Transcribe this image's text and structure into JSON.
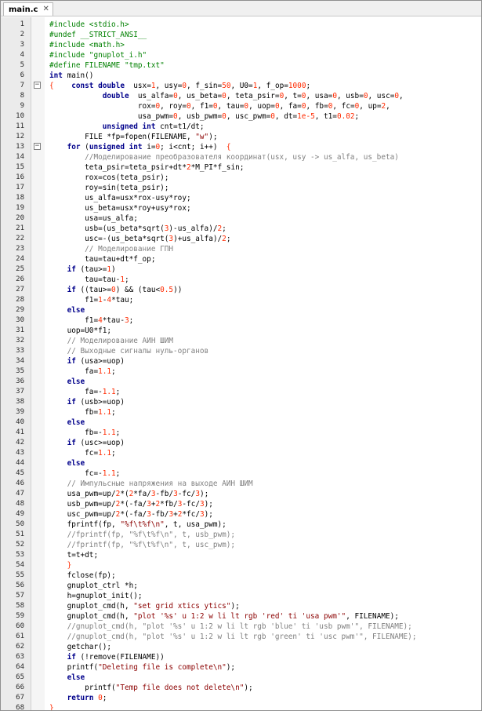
{
  "tab": {
    "label": "main.c",
    "close": "✕"
  },
  "lines": [
    [
      [
        "pp",
        "#include <stdio.h>"
      ]
    ],
    [
      [
        "pp",
        "#undef __STRICT_ANSI__"
      ]
    ],
    [
      [
        "pp",
        "#include <math.h>"
      ]
    ],
    [
      [
        "pp",
        "#include \"gnuplot_i.h\""
      ]
    ],
    [
      [
        "pp",
        "#define FILENAME \"tmp.txt\""
      ]
    ],
    [
      [
        "kw",
        "int"
      ],
      [
        "fn",
        " main()"
      ]
    ],
    [
      [
        "op",
        "{"
      ],
      [
        "fn",
        "    "
      ],
      [
        "kw",
        "const double"
      ],
      [
        "fn",
        "  usx="
      ],
      [
        "num",
        "1"
      ],
      [
        "fn",
        ", usy="
      ],
      [
        "num",
        "0"
      ],
      [
        "fn",
        ", f_sin="
      ],
      [
        "num",
        "50"
      ],
      [
        "fn",
        ", U0="
      ],
      [
        "num",
        "1"
      ],
      [
        "fn",
        ", f_op="
      ],
      [
        "num",
        "1000"
      ],
      [
        "fn",
        ";"
      ]
    ],
    [
      [
        "fn",
        "            "
      ],
      [
        "kw",
        "double"
      ],
      [
        "fn",
        "  us_alfa="
      ],
      [
        "num",
        "0"
      ],
      [
        "fn",
        ", us_beta="
      ],
      [
        "num",
        "0"
      ],
      [
        "fn",
        ", teta_psir="
      ],
      [
        "num",
        "0"
      ],
      [
        "fn",
        ", t="
      ],
      [
        "num",
        "0"
      ],
      [
        "fn",
        ", usa="
      ],
      [
        "num",
        "0"
      ],
      [
        "fn",
        ", usb="
      ],
      [
        "num",
        "0"
      ],
      [
        "fn",
        ", usc="
      ],
      [
        "num",
        "0"
      ],
      [
        "fn",
        ","
      ]
    ],
    [
      [
        "fn",
        "                    rox="
      ],
      [
        "num",
        "0"
      ],
      [
        "fn",
        ", roy="
      ],
      [
        "num",
        "0"
      ],
      [
        "fn",
        ", f1="
      ],
      [
        "num",
        "0"
      ],
      [
        "fn",
        ", tau="
      ],
      [
        "num",
        "0"
      ],
      [
        "fn",
        ", uop="
      ],
      [
        "num",
        "0"
      ],
      [
        "fn",
        ", fa="
      ],
      [
        "num",
        "0"
      ],
      [
        "fn",
        ", fb="
      ],
      [
        "num",
        "0"
      ],
      [
        "fn",
        ", fc="
      ],
      [
        "num",
        "0"
      ],
      [
        "fn",
        ", up="
      ],
      [
        "num",
        "2"
      ],
      [
        "fn",
        ","
      ]
    ],
    [
      [
        "fn",
        "                    usa_pwm="
      ],
      [
        "num",
        "0"
      ],
      [
        "fn",
        ", usb_pwm="
      ],
      [
        "num",
        "0"
      ],
      [
        "fn",
        ", usc_pwm="
      ],
      [
        "num",
        "0"
      ],
      [
        "fn",
        ", dt="
      ],
      [
        "num",
        "1e-5"
      ],
      [
        "fn",
        ", t1="
      ],
      [
        "num",
        "0.02"
      ],
      [
        "fn",
        ";"
      ]
    ],
    [
      [
        "fn",
        "            "
      ],
      [
        "kw",
        "unsigned int"
      ],
      [
        "fn",
        " cnt=t1/dt;"
      ]
    ],
    [
      [
        "fn",
        "        FILE *fp=fopen(FILENAME, "
      ],
      [
        "str",
        "\"w\""
      ],
      [
        "fn",
        ");"
      ]
    ],
    [
      [
        "fn",
        "    "
      ],
      [
        "kw",
        "for"
      ],
      [
        "fn",
        " ("
      ],
      [
        "kw",
        "unsigned int"
      ],
      [
        "fn",
        " i="
      ],
      [
        "num",
        "0"
      ],
      [
        "fn",
        "; i<cnt; i++)  "
      ],
      [
        "op",
        "{"
      ]
    ],
    [
      [
        "cm",
        "        //Моделирование преобразователя координат(usx, usy -> us_alfa, us_beta)"
      ]
    ],
    [
      [
        "fn",
        "        teta_psir=teta_psir+dt*"
      ],
      [
        "num",
        "2"
      ],
      [
        "fn",
        "*M_PI*f_sin;"
      ]
    ],
    [
      [
        "fn",
        "        rox=cos(teta_psir);"
      ]
    ],
    [
      [
        "fn",
        "        roy=sin(teta_psir);"
      ]
    ],
    [
      [
        "fn",
        "        us_alfa=usx*rox-usy*roy;"
      ]
    ],
    [
      [
        "fn",
        "        us_beta=usx*roy+usy*rox;"
      ]
    ],
    [
      [
        "fn",
        "        usa=us_alfa;"
      ]
    ],
    [
      [
        "fn",
        "        usb=(us_beta*sqrt("
      ],
      [
        "num",
        "3"
      ],
      [
        "fn",
        ")-us_alfa)/"
      ],
      [
        "num",
        "2"
      ],
      [
        "fn",
        ";"
      ]
    ],
    [
      [
        "fn",
        "        usc=-(us_beta*sqrt("
      ],
      [
        "num",
        "3"
      ],
      [
        "fn",
        ")+us_alfa)/"
      ],
      [
        "num",
        "2"
      ],
      [
        "fn",
        ";"
      ]
    ],
    [
      [
        "cm",
        "        // Моделирование ГПН"
      ]
    ],
    [
      [
        "fn",
        "        tau=tau+dt*f_op;"
      ]
    ],
    [
      [
        "fn",
        "    "
      ],
      [
        "kw",
        "if"
      ],
      [
        "fn",
        " (tau>="
      ],
      [
        "num",
        "1"
      ],
      [
        "fn",
        ")"
      ]
    ],
    [
      [
        "fn",
        "        tau=tau-"
      ],
      [
        "num",
        "1"
      ],
      [
        "fn",
        ";"
      ]
    ],
    [
      [
        "fn",
        "    "
      ],
      [
        "kw",
        "if"
      ],
      [
        "fn",
        " ((tau>="
      ],
      [
        "num",
        "0"
      ],
      [
        "fn",
        ") && (tau<"
      ],
      [
        "num",
        "0.5"
      ],
      [
        "fn",
        "))"
      ]
    ],
    [
      [
        "fn",
        "        f1="
      ],
      [
        "num",
        "1"
      ],
      [
        "fn",
        "-"
      ],
      [
        "num",
        "4"
      ],
      [
        "fn",
        "*tau;"
      ]
    ],
    [
      [
        "fn",
        "    "
      ],
      [
        "kw",
        "else"
      ]
    ],
    [
      [
        "fn",
        "        f1="
      ],
      [
        "num",
        "4"
      ],
      [
        "fn",
        "*tau-"
      ],
      [
        "num",
        "3"
      ],
      [
        "fn",
        ";"
      ]
    ],
    [
      [
        "fn",
        "    uop=U0*f1;"
      ]
    ],
    [
      [
        "cm",
        "    // Моделирование АИН ШИМ"
      ]
    ],
    [
      [
        "cm",
        "    // Выходные сигналы нуль-органов"
      ]
    ],
    [
      [
        "fn",
        "    "
      ],
      [
        "kw",
        "if"
      ],
      [
        "fn",
        " (usa>=uop)"
      ]
    ],
    [
      [
        "fn",
        "        fa="
      ],
      [
        "num",
        "1.1"
      ],
      [
        "fn",
        ";"
      ]
    ],
    [
      [
        "fn",
        "    "
      ],
      [
        "kw",
        "else"
      ]
    ],
    [
      [
        "fn",
        "        fa=-"
      ],
      [
        "num",
        "1.1"
      ],
      [
        "fn",
        ";"
      ]
    ],
    [
      [
        "fn",
        "    "
      ],
      [
        "kw",
        "if"
      ],
      [
        "fn",
        " (usb>=uop)"
      ]
    ],
    [
      [
        "fn",
        "        fb="
      ],
      [
        "num",
        "1.1"
      ],
      [
        "fn",
        ";"
      ]
    ],
    [
      [
        "fn",
        "    "
      ],
      [
        "kw",
        "else"
      ]
    ],
    [
      [
        "fn",
        "        fb=-"
      ],
      [
        "num",
        "1.1"
      ],
      [
        "fn",
        ";"
      ]
    ],
    [
      [
        "fn",
        "    "
      ],
      [
        "kw",
        "if"
      ],
      [
        "fn",
        " (usc>=uop)"
      ]
    ],
    [
      [
        "fn",
        "        fc="
      ],
      [
        "num",
        "1.1"
      ],
      [
        "fn",
        ";"
      ]
    ],
    [
      [
        "fn",
        "    "
      ],
      [
        "kw",
        "else"
      ]
    ],
    [
      [
        "fn",
        "        fc=-"
      ],
      [
        "num",
        "1.1"
      ],
      [
        "fn",
        ";"
      ]
    ],
    [
      [
        "cm",
        "    // Импульсные напряжения на выходе АИН ШИМ"
      ]
    ],
    [
      [
        "fn",
        "    usa_pwm=up/"
      ],
      [
        "num",
        "2"
      ],
      [
        "fn",
        "*("
      ],
      [
        "num",
        "2"
      ],
      [
        "fn",
        "*fa/"
      ],
      [
        "num",
        "3"
      ],
      [
        "fn",
        "-fb/"
      ],
      [
        "num",
        "3"
      ],
      [
        "fn",
        "-fc/"
      ],
      [
        "num",
        "3"
      ],
      [
        "fn",
        ");"
      ]
    ],
    [
      [
        "fn",
        "    usb_pwm=up/"
      ],
      [
        "num",
        "2"
      ],
      [
        "fn",
        "*(-fa/"
      ],
      [
        "num",
        "3"
      ],
      [
        "fn",
        "+"
      ],
      [
        "num",
        "2"
      ],
      [
        "fn",
        "*fb/"
      ],
      [
        "num",
        "3"
      ],
      [
        "fn",
        "-fc/"
      ],
      [
        "num",
        "3"
      ],
      [
        "fn",
        ");"
      ]
    ],
    [
      [
        "fn",
        "    usc_pwm=up/"
      ],
      [
        "num",
        "2"
      ],
      [
        "fn",
        "*(-fa/"
      ],
      [
        "num",
        "3"
      ],
      [
        "fn",
        "-fb/"
      ],
      [
        "num",
        "3"
      ],
      [
        "fn",
        "+"
      ],
      [
        "num",
        "2"
      ],
      [
        "fn",
        "*fc/"
      ],
      [
        "num",
        "3"
      ],
      [
        "fn",
        ");"
      ]
    ],
    [
      [
        "fn",
        "    fprintf(fp, "
      ],
      [
        "str",
        "\"%f\\t%f\\n\""
      ],
      [
        "fn",
        ", t, usa_pwm);"
      ]
    ],
    [
      [
        "cm",
        "    //fprintf(fp, \"%f\\t%f\\n\", t, usb_pwm);"
      ]
    ],
    [
      [
        "cm",
        "    //fprintf(fp, \"%f\\t%f\\n\", t, usc_pwm);"
      ]
    ],
    [
      [
        "fn",
        "    t=t+dt;"
      ]
    ],
    [
      [
        "op",
        "    }"
      ]
    ],
    [
      [
        "fn",
        "    fclose(fp);"
      ]
    ],
    [
      [
        "fn",
        "    gnuplot_ctrl *h;"
      ]
    ],
    [
      [
        "fn",
        "    h=gnuplot_init();"
      ]
    ],
    [
      [
        "fn",
        "    gnuplot_cmd(h, "
      ],
      [
        "str",
        "\"set grid xtics ytics\""
      ],
      [
        "fn",
        ");"
      ]
    ],
    [
      [
        "fn",
        "    gnuplot_cmd(h, "
      ],
      [
        "str",
        "\"plot '%s' u 1:2 w li lt rgb 'red' ti 'usa pwm'\""
      ],
      [
        "fn",
        ", FILENAME);"
      ]
    ],
    [
      [
        "cm",
        "    //gnuplot_cmd(h, \"plot '%s' u 1:2 w li lt rgb 'blue' ti 'usb pwm'\", FILENAME);"
      ]
    ],
    [
      [
        "cm",
        "    //gnuplot_cmd(h, \"plot '%s' u 1:2 w li lt rgb 'green' ti 'usc pwm'\", FILENAME);"
      ]
    ],
    [
      [
        "fn",
        "    getchar();"
      ]
    ],
    [
      [
        "fn",
        "    "
      ],
      [
        "kw",
        "if"
      ],
      [
        "fn",
        " (!remove(FILENAME))"
      ]
    ],
    [
      [
        "fn",
        "    printf("
      ],
      [
        "str",
        "\"Deleting file is complete\\n\""
      ],
      [
        "fn",
        ");"
      ]
    ],
    [
      [
        "fn",
        "    "
      ],
      [
        "kw",
        "else"
      ]
    ],
    [
      [
        "fn",
        "        printf("
      ],
      [
        "str",
        "\"Temp file does not delete\\n\""
      ],
      [
        "fn",
        ");"
      ]
    ],
    [
      [
        "fn",
        "    "
      ],
      [
        "kw",
        "return"
      ],
      [
        "fn",
        " "
      ],
      [
        "num",
        "0"
      ],
      [
        "fn",
        ";"
      ]
    ],
    [
      [
        "op",
        "}"
      ]
    ]
  ],
  "fold_markers": {
    "7": "−",
    "13": "−"
  },
  "colors": {
    "keyword": "#00008b",
    "preprocessor": "#008000",
    "string": "#8b0000",
    "number": "#ff2a00",
    "comment": "#808080"
  }
}
